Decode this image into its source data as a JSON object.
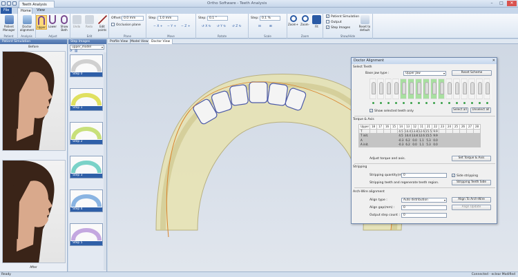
{
  "window": {
    "tab_title": "Teeth Analysis",
    "app_title": "Ortho Software - Teeth Analysis",
    "minimize": "–",
    "maximize": "□",
    "close": "✕"
  },
  "ribbon_tabs": [
    "File",
    "Home",
    "View"
  ],
  "ribbon": {
    "patient_group": {
      "label": "Patient",
      "buttons": [
        "Patient Manager"
      ]
    },
    "analysis_group": {
      "label": "Analysis",
      "buttons": [
        "Doctor alignment"
      ]
    },
    "adjust_group": {
      "label": "Adjust",
      "buttons": [
        "Upper",
        "Lower",
        "Show Both"
      ]
    },
    "edit_group": {
      "label": "Edit",
      "buttons": [
        "Undo",
        "Redo",
        "Edit points"
      ]
    },
    "plane_group": {
      "label": "Plane",
      "offset_label": "Offset:",
      "offset_value": "0.0 mm",
      "occlusion_label": "Occlusion plane"
    },
    "move_group": {
      "label": "Move",
      "step_label": "Step:",
      "step_value": "1.0 mm",
      "controls": [
        "X",
        "Y",
        "Z"
      ]
    },
    "rotate_group": {
      "label": "Rotate",
      "step_label": "Step:",
      "step_value": "0.1 °",
      "controls": [
        "X",
        "Y",
        "Z"
      ]
    },
    "scale_group": {
      "label": "Scale",
      "step_label": "Step:",
      "step_value": "0.1 %"
    },
    "zoom_group": {
      "label": "Zoom",
      "buttons": [
        "Zoom+",
        "Zoom-",
        "Fit"
      ]
    },
    "showhide_group": {
      "label": "Show/Hide",
      "checks": [
        {
          "label": "Patient Simulation",
          "checked": true
        },
        {
          "label": "Output",
          "checked": false
        },
        {
          "label": "Step Images",
          "checked": true
        }
      ]
    },
    "reset_button": "Reset to default"
  },
  "left_panel": {
    "header": "Patient Simulation",
    "before_label": "Before",
    "after_label": "After"
  },
  "steps_panel": {
    "header": "Step Images",
    "model_select": "upper_model",
    "steps": [
      "Step 0",
      "Step 1",
      "Step 2",
      "Step 3",
      "Step 4",
      "Step 5"
    ],
    "step_colors": [
      "#e6e6a0",
      "#e0e060",
      "#c8e07a",
      "#7ad2c8",
      "#8ab4e2",
      "#c4a8e0"
    ]
  },
  "viewport_tabs": [
    "Profile View",
    "Model View",
    "Doctor View"
  ],
  "status": {
    "left": "Ready",
    "right": "Connected - eclear   Modified"
  },
  "dialog": {
    "title": "Doctor Alignment",
    "close": "✕",
    "select_teeth": {
      "section": "Select Teeth",
      "base_jaw_label": "Base jaw type :",
      "base_jaw_value": "Upper Jaw",
      "reset_scheme": "Reset Scheme",
      "show_selected": "Show selected teeth only",
      "select_all": "Select all",
      "unselect_all": "Unselect all"
    },
    "torque": {
      "section": "Torque & Axis",
      "header": [
        "Upper",
        "18",
        "17",
        "16",
        "15",
        "14",
        "13",
        "12",
        "11",
        "21",
        "22",
        "23",
        "24",
        "25",
        "26",
        "27",
        "28"
      ],
      "rows": [
        {
          "label": "T",
          "values": [
            "",
            "",
            "",
            "",
            "4.5",
            "14.4",
            "13.8",
            "12.6",
            "15.5",
            "9.9",
            "",
            "",
            "",
            "",
            "",
            ""
          ]
        },
        {
          "label": "T init.",
          "values": [
            "",
            "",
            "",
            "",
            "4.5",
            "14.4",
            "13.8",
            "12.6",
            "15.5",
            "9.9",
            "",
            "",
            "",
            "",
            "",
            ""
          ]
        },
        {
          "label": "A",
          "values": [
            "",
            "",
            "",
            "",
            "-0.3",
            "6.2",
            "0.0",
            "1.1",
            "5.3",
            "0.0",
            "",
            "",
            "",
            "",
            "",
            ""
          ]
        },
        {
          "label": "A init.",
          "values": [
            "",
            "",
            "",
            "",
            "-0.3",
            "6.2",
            "0.0",
            "1.1",
            "5.3",
            "0.0",
            "",
            "",
            "",
            "",
            "",
            ""
          ]
        }
      ],
      "adjust_text": "Adjust torque and axis.",
      "set_button": "Set Torque & Axis"
    },
    "stripping": {
      "section": "Stripping",
      "quantity_label": "Stripping quantity(mm) :",
      "quantity_value": "0",
      "side_stripping": "Side stripping",
      "regen_text": "Stripping teeth and regenerate teeth region.",
      "button": "Stripping Teeth Side"
    },
    "archwire": {
      "section": "Arch-Wire alignment",
      "align_type_label": "Align type :",
      "align_type_value": "Auto distribution",
      "align_gap_label": "Align gap(mm) :",
      "align_gap_value": "0",
      "output_step_label": "Output step count :",
      "output_step_value": "0",
      "align_button": "Align To Arch-Wire",
      "update_button": "Align Update"
    }
  }
}
